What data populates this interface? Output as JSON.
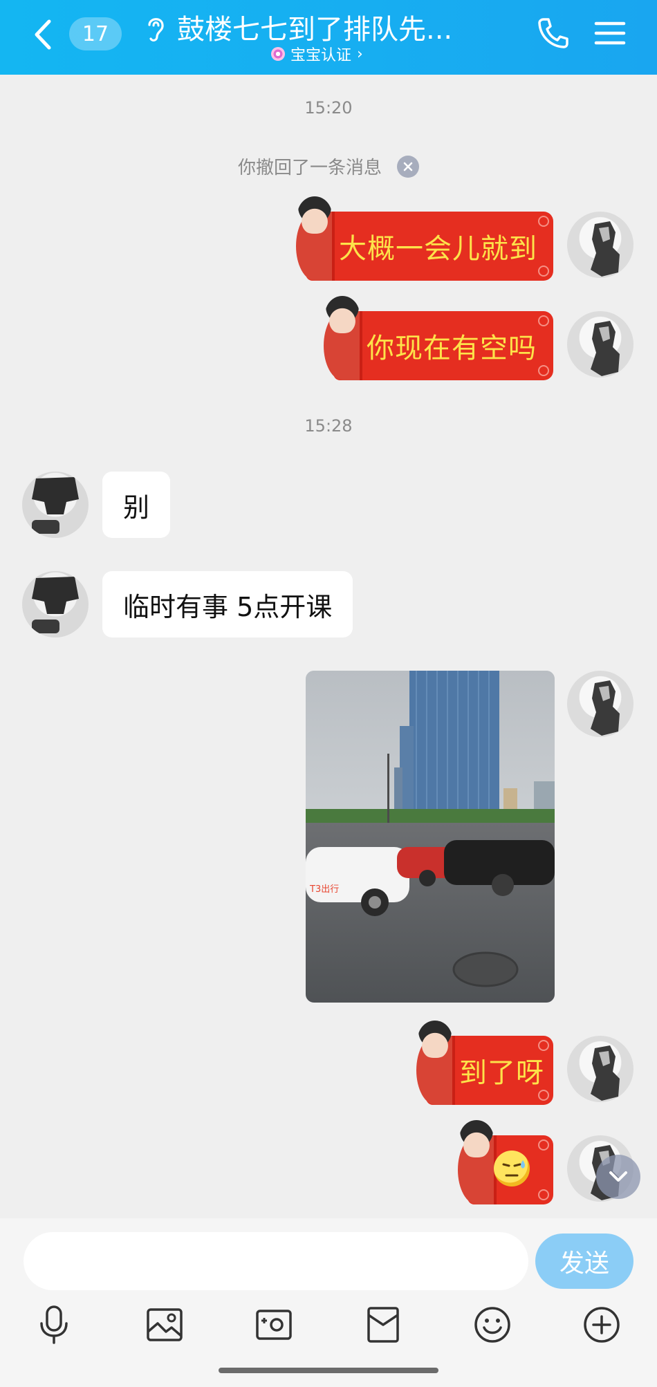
{
  "header": {
    "unread_count": "17",
    "title": "鼓楼七七到了排队先...",
    "subtitle": "宝宝认证",
    "subtitle_chevron": "›"
  },
  "timestamps": [
    "15:20",
    "15:28"
  ],
  "system_message": "你撤回了一条消息",
  "messages": [
    {
      "side": "right",
      "type": "sticker",
      "text": "大概一会儿就到"
    },
    {
      "side": "right",
      "type": "sticker",
      "text": "你现在有空吗"
    },
    {
      "side": "left",
      "type": "text",
      "text": "别"
    },
    {
      "side": "left",
      "type": "text",
      "text": "临时有事 5点开课"
    },
    {
      "side": "right",
      "type": "image",
      "alt": "street photo",
      "sign_text": "T3出行"
    },
    {
      "side": "right",
      "type": "sticker",
      "text": "到了呀"
    },
    {
      "side": "right",
      "type": "sticker",
      "text": ""
    }
  ],
  "composer": {
    "input_value": "",
    "send_label": "发送"
  },
  "toolbar_icons": [
    "microphone-icon",
    "image-icon",
    "camera-icon",
    "red-packet-icon",
    "emoji-icon",
    "plus-icon"
  ],
  "colors": {
    "header": "#17aef1",
    "sticker_red": "#e52e20",
    "sticker_text": "#fde34a",
    "send_button": "#8bcdf6",
    "background": "#efefef"
  }
}
